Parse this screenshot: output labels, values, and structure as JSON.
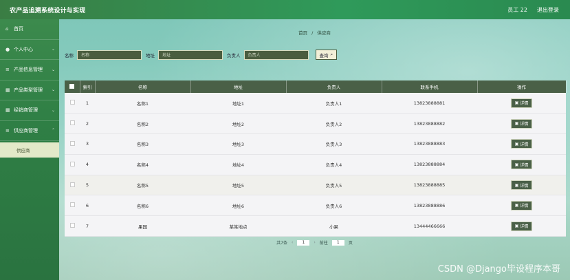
{
  "header": {
    "app_title": "农产品追溯系统设计与实现",
    "user": "员工 22",
    "logout": "退出登录"
  },
  "sidebar": {
    "items": [
      {
        "label": "首页",
        "icon": "home-icon"
      },
      {
        "label": "个人中心",
        "icon": "user-icon"
      },
      {
        "label": "产品信息管理",
        "icon": "list-icon"
      },
      {
        "label": "产品类型管理",
        "icon": "grid-icon"
      },
      {
        "label": "经销商管理",
        "icon": "grid-icon"
      },
      {
        "label": "供应商管理",
        "icon": "list-icon"
      }
    ],
    "sub_item": "供应商"
  },
  "breadcrumb": {
    "home": "首页",
    "sep": "/",
    "current": "供应商"
  },
  "search": {
    "name_label": "名称",
    "name_placeholder": "名称",
    "address_label": "地址",
    "address_placeholder": "地址",
    "person_label": "负责人",
    "person_placeholder": "负责人",
    "button": "查询"
  },
  "table": {
    "headers": {
      "index": "索引",
      "name": "名称",
      "address": "地址",
      "person": "负责人",
      "phone": "联系手机",
      "action": "操作"
    },
    "detail_label": "详情",
    "rows": [
      {
        "idx": "1",
        "name": "名称1",
        "address": "地址1",
        "person": "负责人1",
        "phone": "13823888881"
      },
      {
        "idx": "2",
        "name": "名称2",
        "address": "地址2",
        "person": "负责人2",
        "phone": "13823888882"
      },
      {
        "idx": "3",
        "name": "名称3",
        "address": "地址3",
        "person": "负责人3",
        "phone": "13823888883"
      },
      {
        "idx": "4",
        "name": "名称4",
        "address": "地址4",
        "person": "负责人4",
        "phone": "13823888884"
      },
      {
        "idx": "5",
        "name": "名称5",
        "address": "地址5",
        "person": "负责人5",
        "phone": "13823888885"
      },
      {
        "idx": "6",
        "name": "名称6",
        "address": "地址6",
        "person": "负责人6",
        "phone": "13823888886"
      },
      {
        "idx": "7",
        "name": "果园",
        "address": "某某地点",
        "person": "小果",
        "phone": "13444466666"
      }
    ]
  },
  "pager": {
    "total_label": "共7条",
    "prev": "‹",
    "page": "1",
    "next": "›",
    "goto_label": "前往",
    "goto_value": "1",
    "page_suffix": "页"
  },
  "watermark": "CSDN @Django毕设程序本哥",
  "colors": {
    "brand_green": "#3a7d44",
    "table_header": "#4a6047",
    "submenu_bg": "#e3e9c9"
  }
}
